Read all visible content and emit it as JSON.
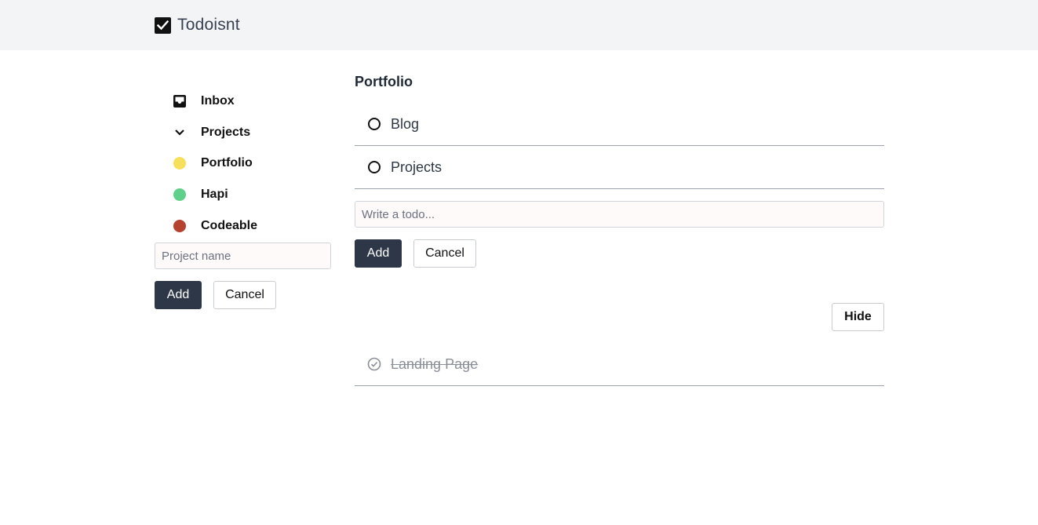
{
  "app": {
    "title": "Todoisnt"
  },
  "sidebar": {
    "items": [
      {
        "label": "Inbox",
        "icon": "inbox-icon"
      },
      {
        "label": "Projects",
        "icon": "chevron-down-icon"
      },
      {
        "label": "Portfolio",
        "icon": "project-dot",
        "color": "#f6df5a"
      },
      {
        "label": "Hapi",
        "icon": "project-dot",
        "color": "#5fd08a"
      },
      {
        "label": "Codeable",
        "icon": "project-dot",
        "color": "#b6412e"
      }
    ],
    "new_project": {
      "placeholder": "Project name",
      "add_label": "Add",
      "cancel_label": "Cancel"
    }
  },
  "main": {
    "title": "Portfolio",
    "todos": [
      {
        "text": "Blog"
      },
      {
        "text": "Projects"
      }
    ],
    "new_todo": {
      "placeholder": "Write a todo...",
      "add_label": "Add",
      "cancel_label": "Cancel"
    },
    "hide_label": "Hide",
    "completed": [
      {
        "text": "Landing Page"
      }
    ]
  },
  "colors": {
    "topbar": "#f3f4f6",
    "primary_button": "#2d3748",
    "portfolio": "#f6df5a",
    "hapi": "#5fd08a",
    "codeable": "#b6412e"
  }
}
